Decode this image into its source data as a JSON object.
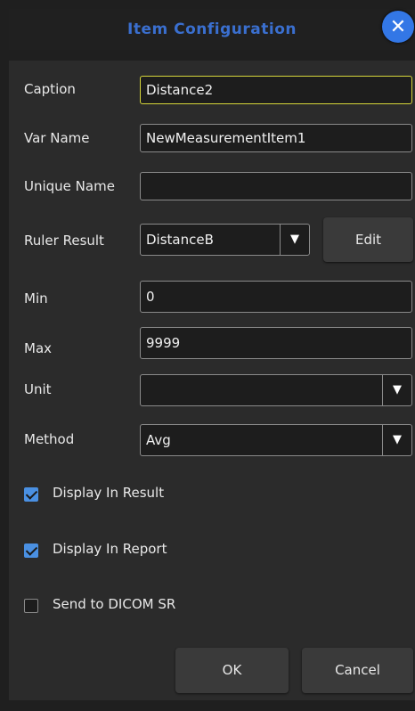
{
  "dialog": {
    "title": "Item Configuration",
    "close_label": "✕"
  },
  "fields": {
    "caption": {
      "label": "Caption",
      "value": "Distance2"
    },
    "var_name": {
      "label": "Var Name",
      "value": "NewMeasurementItem1"
    },
    "unique_name": {
      "label": "Unique Name",
      "value": ""
    },
    "ruler_result": {
      "label": "Ruler Result",
      "value": "DistanceB",
      "edit_label": "Edit"
    },
    "min": {
      "label": "Min",
      "value": "0"
    },
    "max": {
      "label": "Max",
      "value": "9999"
    },
    "unit": {
      "label": "Unit",
      "value": ""
    },
    "method": {
      "label": "Method",
      "value": "Avg"
    }
  },
  "options": {
    "display_in_result": {
      "label": "Display In Result",
      "checked": true
    },
    "display_in_report": {
      "label": "Display In Report",
      "checked": true
    },
    "send_to_dicom_sr": {
      "label": "Send to DICOM SR",
      "checked": false
    }
  },
  "footer": {
    "ok_label": "OK",
    "cancel_label": "Cancel"
  },
  "dropdown_arrow": "▼",
  "colors": {
    "accent": "#3377e6",
    "title": "#3a6fcf",
    "focus_border": "#d6d63a",
    "checkbox": "#4a90e2"
  }
}
